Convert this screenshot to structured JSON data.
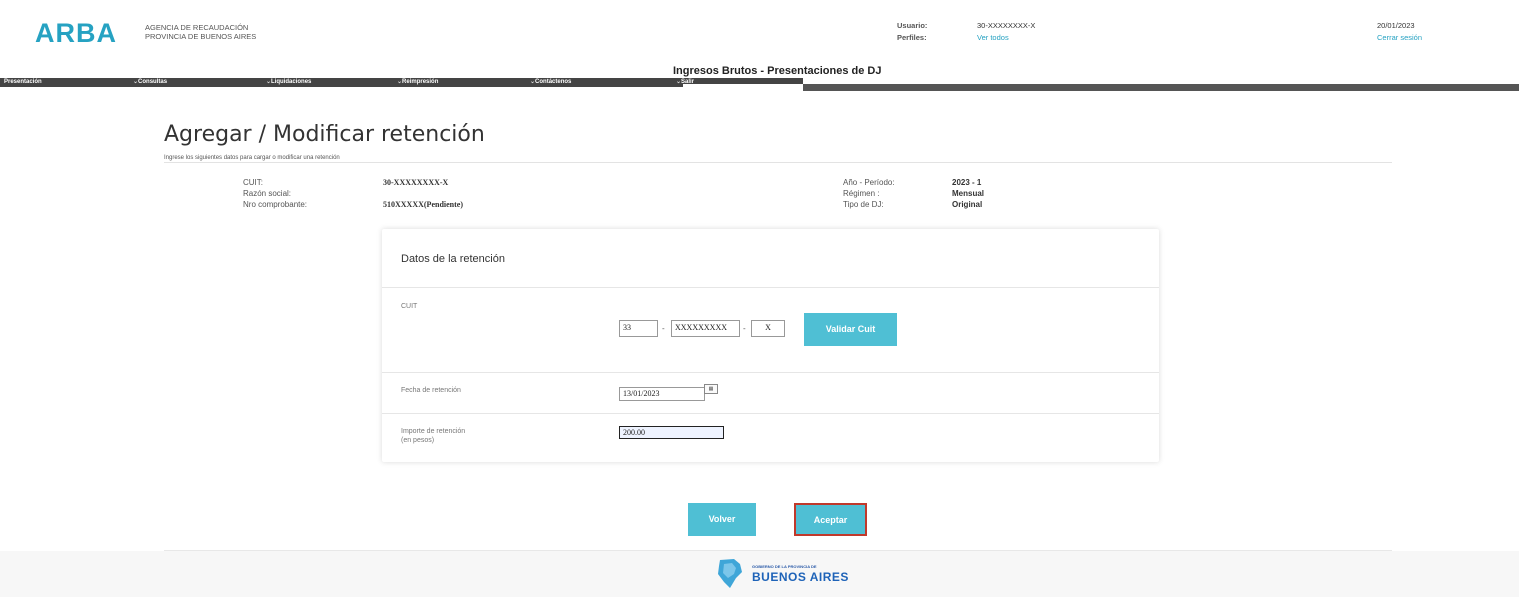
{
  "header": {
    "logo": "ARBA",
    "agency_line1": "AGENCIA DE RECAUDACIÓN",
    "agency_line2": "PROVINCIA DE BUENOS AIRES",
    "usuario_label": "Usuario:",
    "usuario_value": "30-XXXXXXXX-X",
    "perfiles_label": "Perfiles:",
    "perfiles_link": "Ver todos",
    "date": "20/01/2023",
    "logout": "Cerrar sesión"
  },
  "system_title": "Ingresos Brutos - Presentaciones de DJ",
  "nav": {
    "items": [
      "Presentación",
      "Consultas",
      "Liquidaciones",
      "Reimpresión",
      "Contáctenos",
      "Salir"
    ]
  },
  "page": {
    "title": "Agregar / Modificar retención",
    "subtitle": "Ingrese los siguientes datos para cargar o modificar una retención"
  },
  "info": {
    "cuit_label": "CUIT:",
    "cuit_value": "30-XXXXXXXX-X",
    "razon_label": "Razón social:",
    "nro_label": "Nro comprobante:",
    "nro_value": "510XXXXX(Pendiente)",
    "anio_label": "Año - Período:",
    "anio_value": "2023 - 1",
    "regimen_label": "Régimen :",
    "regimen_value": "Mensual",
    "tipo_label": "Tipo de DJ:",
    "tipo_value": "Original"
  },
  "card": {
    "title": "Datos de la retención",
    "cuit_label": "CUIT",
    "cuit_part1": "33",
    "cuit_part2": "XXXXXXXXX",
    "cuit_part3": "X",
    "validar_label": "Validar Cuit",
    "fecha_label": "Fecha de retención",
    "fecha_value": "13/01/2023",
    "importe_label_1": "Importe de retención",
    "importe_label_2": "(en pesos)",
    "importe_value": "200.00"
  },
  "actions": {
    "volver": "Volver",
    "aceptar": "Aceptar"
  },
  "footer": {
    "small": "GOBIERNO DE LA PROVINCIA DE",
    "big": "BUENOS AIRES"
  },
  "colors": {
    "accent": "#26a2c2",
    "button": "#4fbfd4",
    "focus_border": "#c0392b"
  }
}
